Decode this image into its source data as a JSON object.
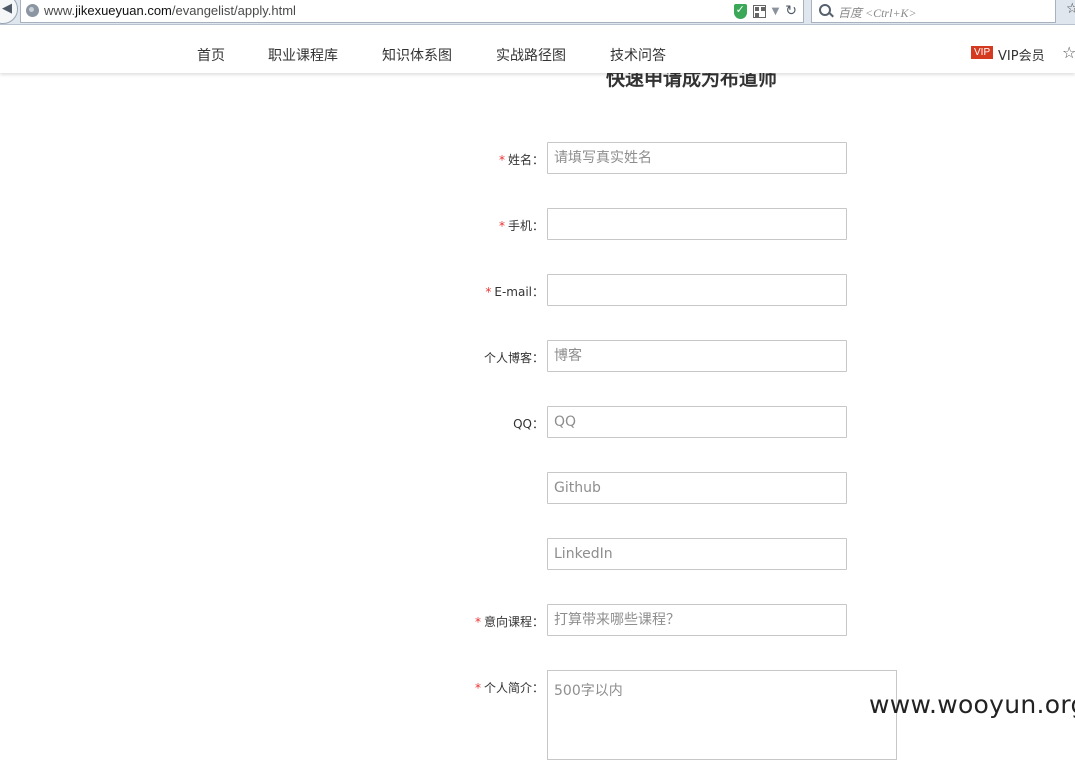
{
  "browser": {
    "url_prefix": "www.",
    "url_domain": "jikexueyuan.com",
    "url_path": "/evangelist/apply.html",
    "search_placeholder": "百度 <Ctrl+K>"
  },
  "nav": {
    "items": [
      {
        "label": "首页"
      },
      {
        "label": "职业课程库"
      },
      {
        "label": "知识体系图"
      },
      {
        "label": "实战路径图"
      },
      {
        "label": "技术问答"
      }
    ],
    "vip_badge": "VIP",
    "vip_label": "VIP会员"
  },
  "form": {
    "title": "快速申请成为布道师",
    "required_mark": "*",
    "fields": [
      {
        "label": "姓名：",
        "required": true,
        "placeholder": "请填写真实姓名"
      },
      {
        "label": "手机：",
        "required": true,
        "placeholder": ""
      },
      {
        "label": "E-mail：",
        "required": true,
        "placeholder": ""
      },
      {
        "label": "个人博客：",
        "required": false,
        "placeholder": "博客"
      },
      {
        "label": "QQ：",
        "required": false,
        "placeholder": "QQ"
      },
      {
        "label": "",
        "required": false,
        "placeholder": "Github"
      },
      {
        "label": "",
        "required": false,
        "placeholder": "LinkedIn"
      },
      {
        "label": "意向课程：",
        "required": true,
        "placeholder": "打算带来哪些课程？"
      }
    ],
    "intro": {
      "label": "个人简介：",
      "required": true,
      "placeholder": "500字以内"
    }
  },
  "watermark": "www.wooyun.org"
}
